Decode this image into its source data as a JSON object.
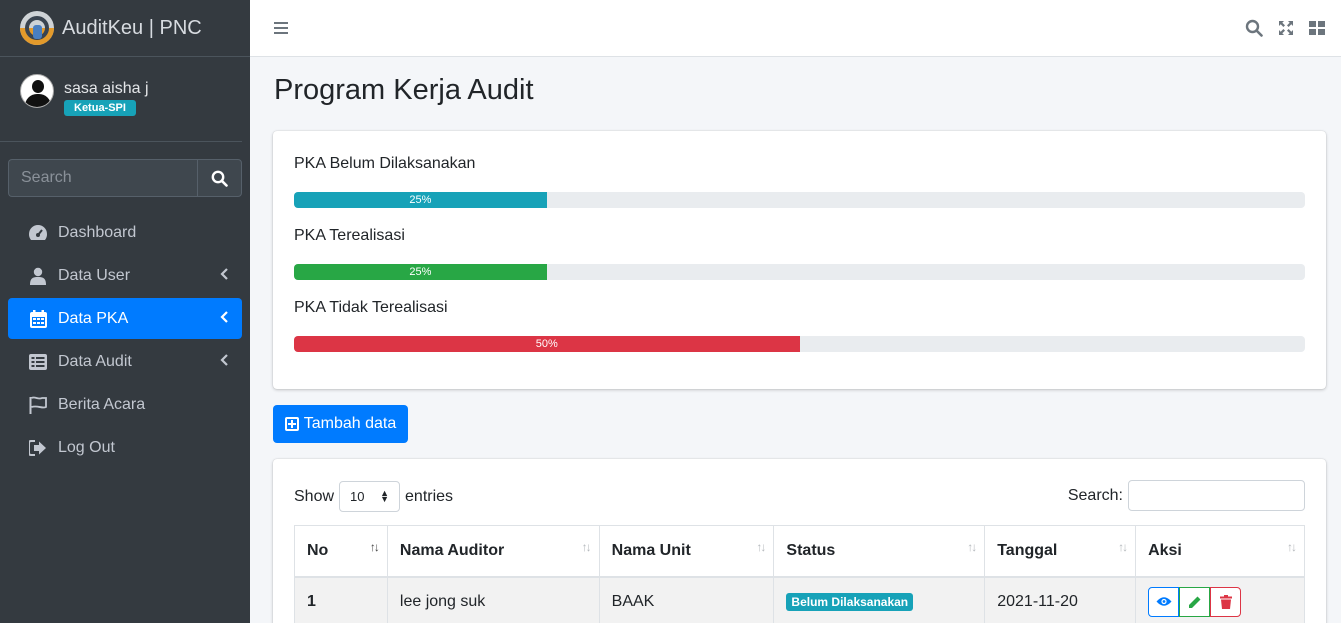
{
  "brand": {
    "title": "AuditKeu | PNC"
  },
  "user": {
    "name": "sasa aisha j",
    "role": "Ketua-SPI"
  },
  "sidebar": {
    "search_placeholder": "Search",
    "items": [
      {
        "label": "Dashboard",
        "icon": "tachometer-icon"
      },
      {
        "label": "Data User",
        "icon": "user-icon"
      },
      {
        "label": "Data PKA",
        "icon": "calendar-icon"
      },
      {
        "label": "Data Audit",
        "icon": "list-icon"
      },
      {
        "label": "Berita Acara",
        "icon": "flag-icon"
      },
      {
        "label": "Log Out",
        "icon": "sign-out-icon"
      }
    ]
  },
  "page": {
    "title": "Program Kerja Audit"
  },
  "progress": [
    {
      "label": "PKA Belum Dilaksanakan",
      "percent": 25,
      "text": "25%",
      "color": "#17a2b8"
    },
    {
      "label": "PKA Terealisasi",
      "percent": 25,
      "text": "25%",
      "color": "#28a745"
    },
    {
      "label": "PKA Tidak Terealisasi",
      "percent": 50,
      "text": "50%",
      "color": "#dc3545"
    }
  ],
  "actions": {
    "add_label": "Tambah data"
  },
  "table": {
    "show_label": "Show",
    "entries_value": "10",
    "entries_label": "entries",
    "search_label": "Search:",
    "columns": [
      "No",
      "Nama Auditor",
      "Nama Unit",
      "Status",
      "Tanggal",
      "Aksi"
    ],
    "rows": [
      {
        "no": "1",
        "auditor": "lee jong suk",
        "unit": "BAAK",
        "status": "Belum Dilaksanakan",
        "tanggal": "2021-11-20"
      }
    ]
  },
  "colors": {
    "sidebar": "#343a40",
    "primary": "#007bff",
    "info": "#17a2b8",
    "success": "#28a745",
    "danger": "#dc3545"
  }
}
